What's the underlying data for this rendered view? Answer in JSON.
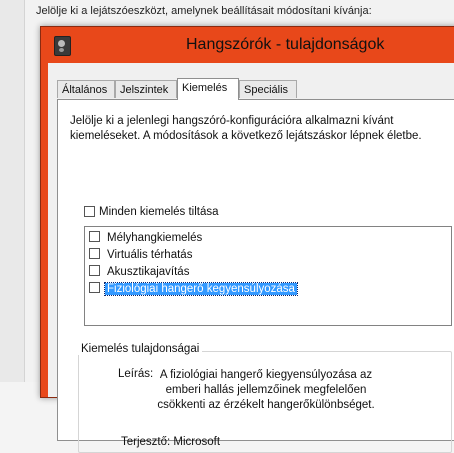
{
  "background": {
    "instruction": "Jelölje ki a lejátszóeszközt, amelynek beállításait módosítani kívánja:"
  },
  "dialog": {
    "title": "Hangszórók - tulajdonságok",
    "title_icon": "speaker-icon",
    "accent_color": "#e8481a"
  },
  "tabs": [
    {
      "label": "Általános"
    },
    {
      "label": "Jelszintek"
    },
    {
      "label": "Kiemelés"
    },
    {
      "label": "Speciális"
    }
  ],
  "active_tab": "Kiemelés",
  "panel": {
    "description": "Jelölje ki a jelenlegi hangszóró-konfigurációra alkalmazni kívánt kiemeléseket. A módosítások a következő lejátszáskor lépnek életbe.",
    "disable_all_label": "Minden kiemelés tiltása",
    "disable_all_checked": false,
    "enhancements": [
      {
        "label": "Mélyhangkiemelés",
        "checked": false
      },
      {
        "label": "Virtuális térhatás",
        "checked": false
      },
      {
        "label": "Akusztikajavítás",
        "checked": false
      },
      {
        "label": "Fiziológiai hangerő kegyensúlyozása",
        "checked": false,
        "selected": true
      }
    ],
    "properties": {
      "group_title": "Kiemelés tulajdonságai",
      "description_label": "Leírás:",
      "description_value": "A fiziológiai hangerő kiegyensúlyozása az emberi hallás jellemzőinek megfelelően csökkenti az érzékelt hangerőkülönbséget.",
      "provider_text": "Terjesztő: Microsoft"
    }
  }
}
